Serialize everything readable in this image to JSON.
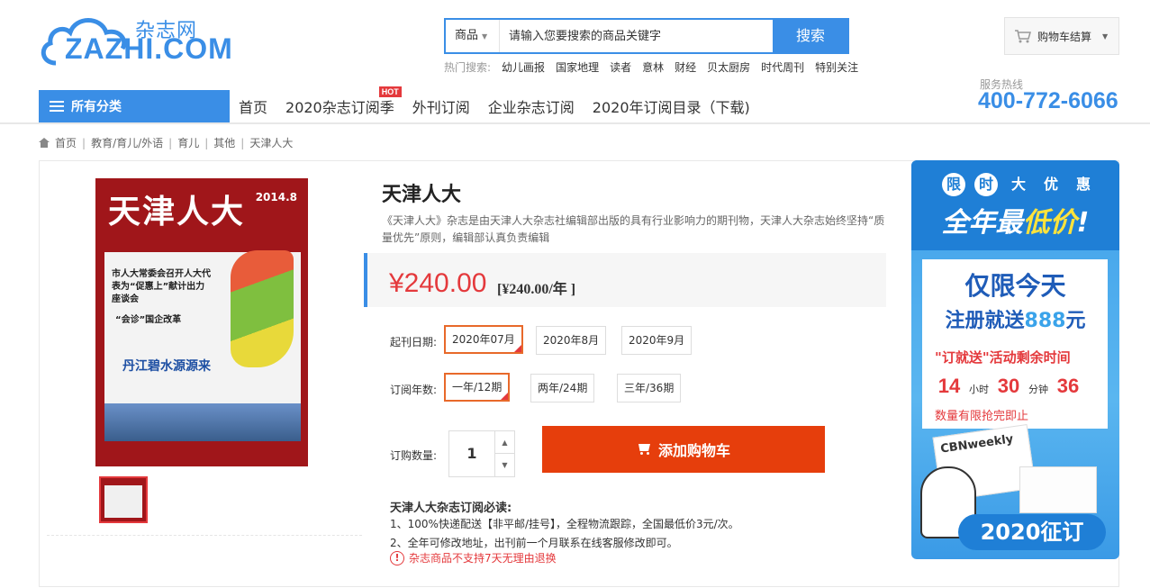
{
  "logo": {
    "cn": "杂志网",
    "en": "ZAZHI.COM"
  },
  "search": {
    "scope": "商品",
    "placeholder": "请输入您要搜索的商品关键字",
    "button": "搜索"
  },
  "hot": {
    "label": "热门搜索:",
    "links": [
      "幼儿画报",
      "国家地理",
      "读者",
      "意林",
      "财经",
      "贝太厨房",
      "时代周刊",
      "特别关注"
    ]
  },
  "cart": {
    "label": "购物车结算"
  },
  "hotline": {
    "label": "服务热线",
    "number": "400-772-6066"
  },
  "nav": {
    "all": "所有分类",
    "items": [
      "首页",
      "2020杂志订阅季",
      "外刊订阅",
      "企业杂志订阅",
      "2020年订阅目录（下载)"
    ],
    "hot_badge": "HOT"
  },
  "breadcrumb": [
    "首页",
    "教育/育儿/外语",
    "育儿",
    "其他",
    "天津人大"
  ],
  "cover": {
    "title": "天津人大",
    "issue": "2014.8",
    "h1": "市人大常委会召开人大代表为“促惠上”献计出力座谈会",
    "h2": "“会诊”国企改革",
    "h3": "丹江碧水源源来"
  },
  "product": {
    "title": "天津人大",
    "desc": "《天津人大》杂志是由天津人大杂志社编辑部出版的具有行业影响力的期刊物，天津人大杂志始终坚持“质量优先”原则，编辑部认真负责编辑",
    "price": "¥240.00",
    "unit": "[¥240.00/年 ]"
  },
  "start_date": {
    "label": "起刊日期:",
    "options": [
      "2020年07月",
      "2020年8月",
      "2020年9月"
    ],
    "selected": 0
  },
  "years": {
    "label": "订阅年数:",
    "options": [
      "一年/12期",
      "两年/24期",
      "三年/36期"
    ],
    "selected": 0
  },
  "quantity": {
    "label": "订购数量:",
    "value": "1"
  },
  "add_to_cart": "添加购物车",
  "notice": {
    "title": "天津人大杂志订阅必读:",
    "lines": [
      "1、100%快递配送【非平邮/挂号】，全程物流跟踪，全国最低价3元/次。",
      "2、全年可修改地址，出刊前一个月联系在线客服修改即可。"
    ],
    "warning": "杂志商品不支持7天无理由退换"
  },
  "ad": {
    "chars": [
      "限",
      "时",
      "大",
      "优",
      "惠"
    ],
    "big_a": "全年最",
    "big_b": "低价",
    "big_c": "!",
    "line1": "仅限今天",
    "line2a": "注册就送",
    "line2b": "888",
    "line2c": "元",
    "line3": "\"订就送\"活动剩余时间",
    "hours": "14",
    "hours_unit": "小时",
    "minutes": "30",
    "minutes_unit": "分钟",
    "seconds": "36",
    "line4": "数量有限抢完即止",
    "magazine": "CBNweekly",
    "pill": "2020征订"
  },
  "colors": {
    "brand": "#3a8ee6",
    "price": "#e4393c",
    "cta": "#e63e0c",
    "selected_border": "#e8692a"
  }
}
